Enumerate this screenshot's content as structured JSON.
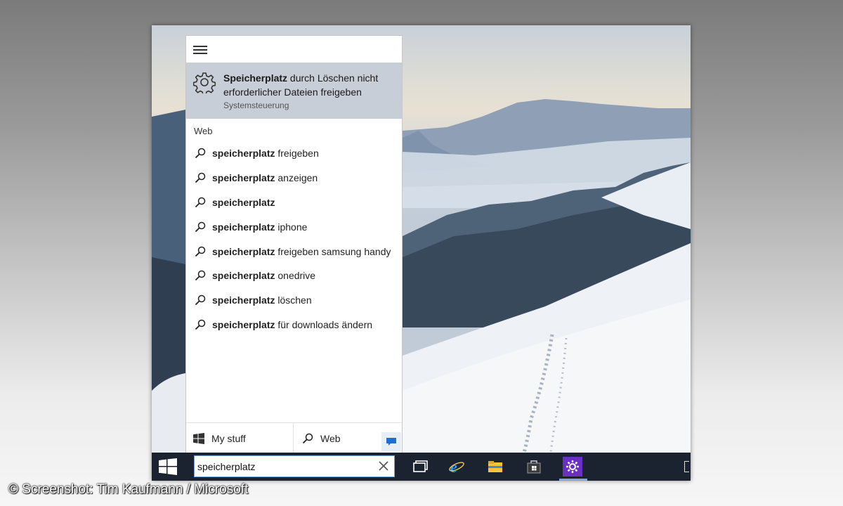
{
  "menu": {
    "icon": "hamburger-icon"
  },
  "best_match": {
    "icon": "gear-icon",
    "title_bold": "Speicherplatz",
    "title_rest": " durch Löschen nicht erforderlicher Dateien freigeben",
    "subtitle": "Systemsteuerung"
  },
  "web_section": {
    "label": "Web"
  },
  "suggestions": [
    {
      "bold": "speicherplatz",
      "rest": " freigeben"
    },
    {
      "bold": "speicherplatz",
      "rest": " anzeigen"
    },
    {
      "bold": "speicherplatz",
      "rest": ""
    },
    {
      "bold": "speicherplatz",
      "rest": " iphone"
    },
    {
      "bold": "speicherplatz",
      "rest": " freigeben samsung handy"
    },
    {
      "bold": "speicherplatz",
      "rest": " onedrive"
    },
    {
      "bold": "speicherplatz",
      "rest": " löschen"
    },
    {
      "bold": "speicherplatz",
      "rest": " für downloads ändern"
    }
  ],
  "bottom_bar": {
    "my_stuff_label": "My stuff",
    "web_label": "Web"
  },
  "taskbar": {
    "search_value": "speicherplatz",
    "icons": [
      "windows-logo-icon",
      "task-view-icon",
      "internet-explorer-icon",
      "file-explorer-icon",
      "store-icon",
      "settings-icon",
      "feedback-icon"
    ]
  },
  "colors": {
    "taskbar": "#1b2230",
    "highlight": "#c8ced8",
    "accent": "#7fa7e0",
    "settings_tile": "#6b2fc4"
  },
  "credit": "© Screenshot: Tim Kaufmann / Microsoft"
}
